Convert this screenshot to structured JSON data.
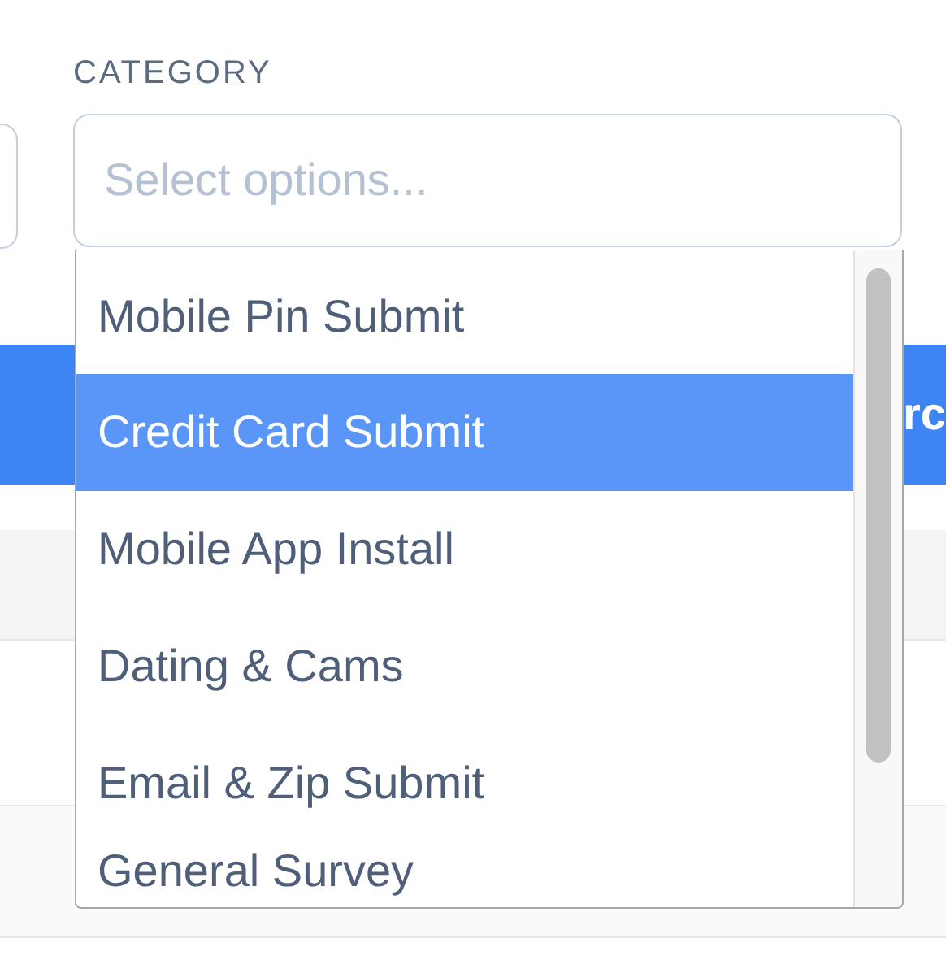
{
  "category": {
    "label": "CATEGORY",
    "placeholder": "Select options...",
    "options": [
      {
        "label": "Mobile Pin Submit",
        "selected": false
      },
      {
        "label": "Credit Card Submit",
        "selected": true
      },
      {
        "label": "Mobile App Install",
        "selected": false
      },
      {
        "label": "Dating & Cams",
        "selected": false
      },
      {
        "label": "Email & Zip Submit",
        "selected": false
      },
      {
        "label": "General Survey",
        "selected": false
      }
    ]
  },
  "search_button": {
    "label": "rc"
  }
}
